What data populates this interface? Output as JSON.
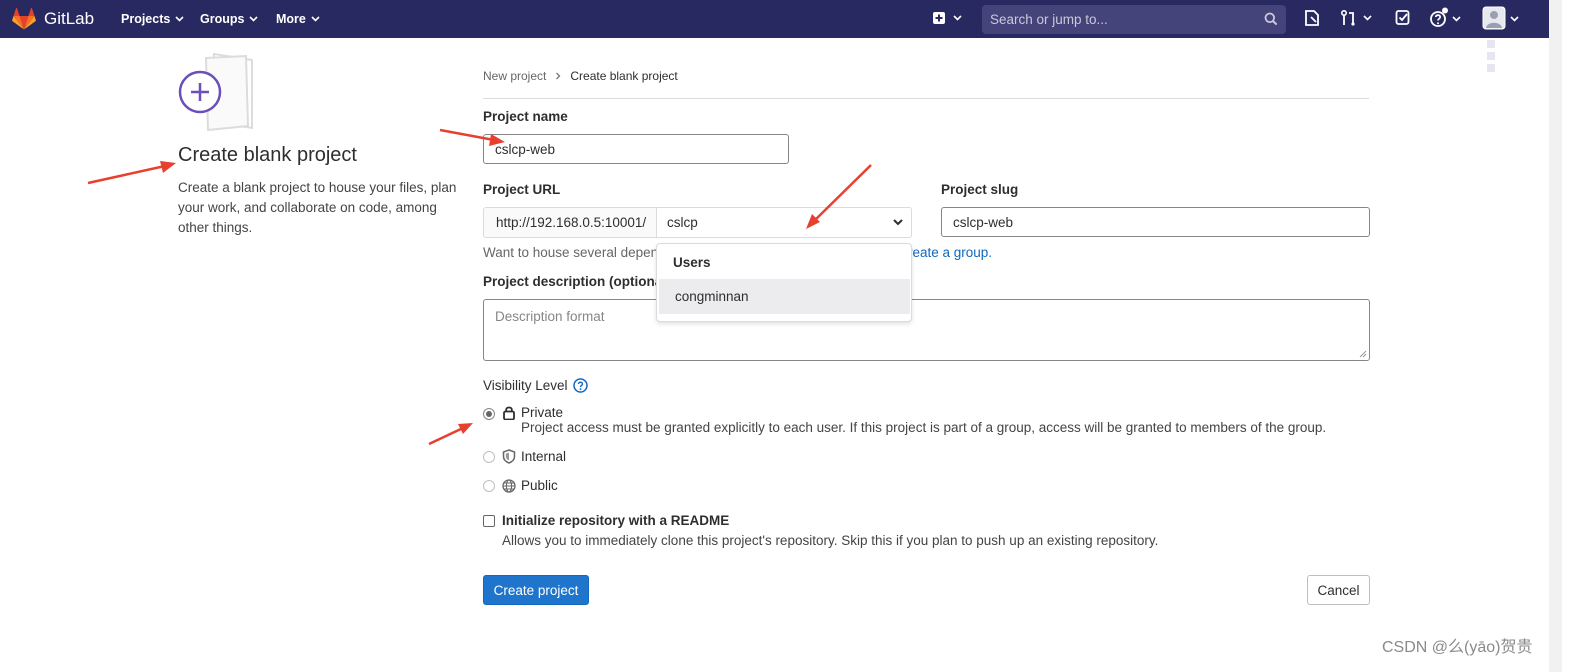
{
  "nav": {
    "brand": "GitLab",
    "projects": "Projects",
    "groups": "Groups",
    "more": "More",
    "search_placeholder": "Search or jump to..."
  },
  "intro": {
    "title": "Create blank project",
    "description": "Create a blank project to house your files, plan your work, and collaborate on code, among other things."
  },
  "breadcrumb": {
    "parent": "New project",
    "current": "Create blank project"
  },
  "form": {
    "project_name_label": "Project name",
    "project_name_value": "cslcp-web",
    "project_url_label": "Project URL",
    "url_prefix": "http://192.168.0.5:10001/",
    "namespace_value": "cslcp",
    "project_slug_label": "Project slug",
    "project_slug_value": "cslcp-web",
    "help_text": "Want to house several depen",
    "help_link": "reate a group.",
    "namespace_dropdown": {
      "header": "Users",
      "items": [
        "congminnan"
      ]
    },
    "description_label": "Project description (optional",
    "description_placeholder": "Description format",
    "visibility_label": "Visibility Level",
    "visibility": {
      "private": {
        "label": "Private",
        "description": "Project access must be granted explicitly to each user. If this project is part of a group, access will be granted to members of the group.",
        "selected": true
      },
      "internal": {
        "label": "Internal"
      },
      "public": {
        "label": "Public"
      }
    },
    "readme_label": "Initialize repository with a README",
    "readme_description": "Allows you to immediately clone this project's repository. Skip this if you plan to push up an existing repository.",
    "create_button": "Create project",
    "cancel_button": "Cancel"
  },
  "watermark": "CSDN @么(yāo)贺贵",
  "colors": {
    "navbar": "#292961",
    "primary": "#1f75cb",
    "link": "#1068bf",
    "annotation_arrow": "#e8402f",
    "illustration_accent": "#6b4fbb"
  }
}
